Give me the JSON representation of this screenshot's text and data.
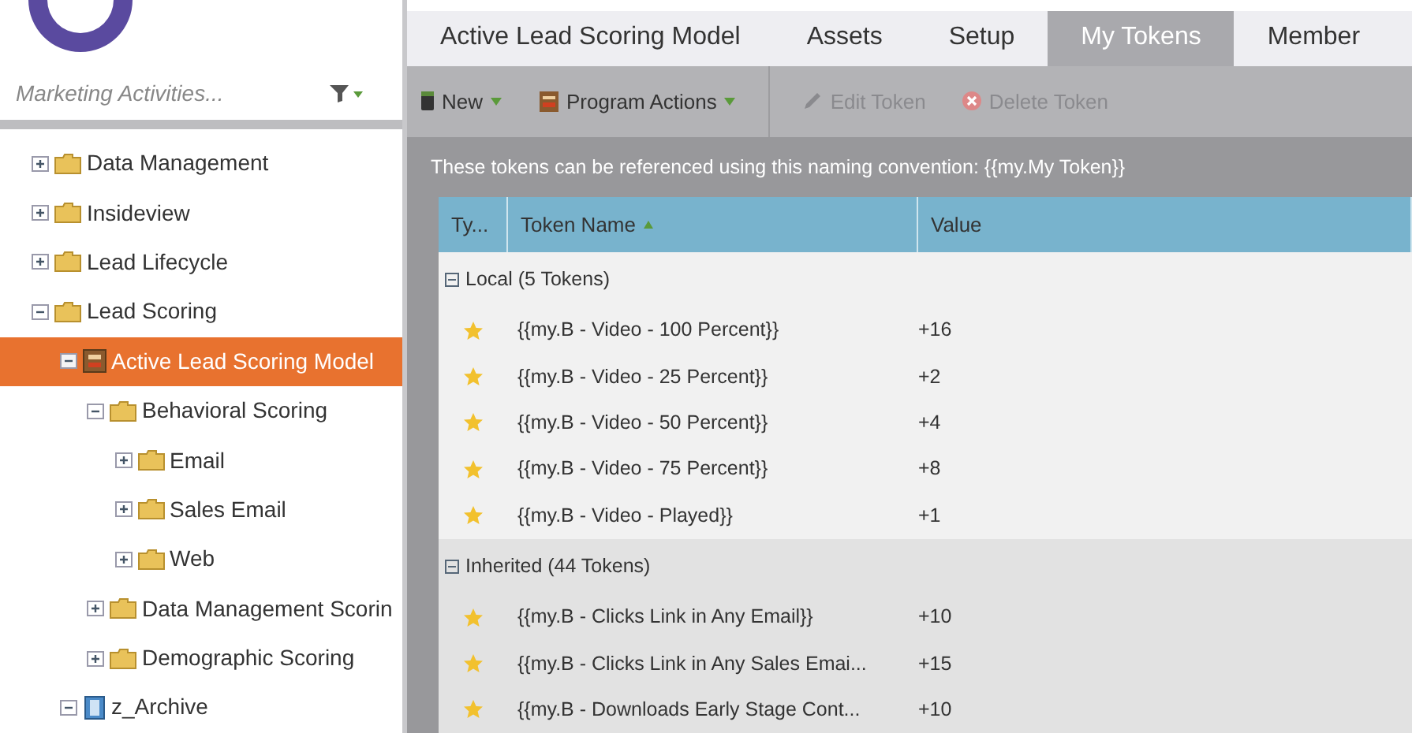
{
  "sidebar": {
    "search": {
      "placeholder": "Marketing Activities..."
    },
    "tree": [
      {
        "label": "Data Management",
        "kind": "folder",
        "expanded": false,
        "selected": false
      },
      {
        "label": "Insideview",
        "kind": "folder",
        "expanded": false,
        "selected": false
      },
      {
        "label": "Lead Lifecycle",
        "kind": "folder",
        "expanded": false,
        "selected": false
      },
      {
        "label": "Lead Scoring",
        "kind": "folder",
        "expanded": true,
        "selected": false,
        "children": [
          {
            "label": "Active Lead Scoring Model",
            "kind": "program",
            "expanded": true,
            "selected": true,
            "children": [
              {
                "label": "Behavioral Scoring",
                "kind": "folder",
                "expanded": true,
                "selected": false,
                "children": [
                  {
                    "label": "Email",
                    "kind": "folder",
                    "expanded": false,
                    "selected": false
                  },
                  {
                    "label": "Sales Email",
                    "kind": "folder",
                    "expanded": false,
                    "selected": false
                  },
                  {
                    "label": "Web",
                    "kind": "folder",
                    "expanded": false,
                    "selected": false
                  }
                ]
              },
              {
                "label": "Data Management Scorin",
                "kind": "folder",
                "expanded": false,
                "selected": false
              },
              {
                "label": "Demographic Scoring",
                "kind": "folder",
                "expanded": false,
                "selected": false
              }
            ]
          },
          {
            "label": "z_Archive",
            "kind": "archive",
            "expanded": true,
            "selected": false
          }
        ]
      }
    ]
  },
  "tabs": [
    {
      "label": "Active Lead Scoring Model",
      "selected": false
    },
    {
      "label": "Assets",
      "selected": false
    },
    {
      "label": "Setup",
      "selected": false
    },
    {
      "label": "My Tokens",
      "selected": true
    },
    {
      "label": "Member",
      "selected": false
    }
  ],
  "toolbar": [
    {
      "label": "New",
      "kind": "new",
      "menu": true,
      "disabled": false
    },
    {
      "label": "Program Actions",
      "kind": "program",
      "menu": true,
      "disabled": false
    },
    {
      "label": "Edit Token",
      "kind": "edit",
      "menu": false,
      "disabled": true
    },
    {
      "label": "Delete Token",
      "kind": "delete",
      "menu": false,
      "disabled": true
    }
  ],
  "info": "These tokens can be referenced using this naming convention: {{my.My Token}}",
  "table": {
    "columns": [
      "Ty...",
      "Token Name",
      "Value"
    ],
    "groups": [
      {
        "label": "Local (5 Tokens)",
        "tokens": [
          {
            "name": "{{my.B - Video - 100 Percent}}",
            "value": "+16"
          },
          {
            "name": "{{my.B - Video - 25 Percent}}",
            "value": "+2"
          },
          {
            "name": "{{my.B - Video - 50 Percent}}",
            "value": "+4"
          },
          {
            "name": "{{my.B - Video - 75 Percent}}",
            "value": "+8"
          },
          {
            "name": "{{my.B - Video - Played}}",
            "value": "+1"
          }
        ]
      },
      {
        "label": "Inherited (44 Tokens)",
        "tokens": [
          {
            "name": "{{my.B - Clicks Link in Any Email}}",
            "value": "+10"
          },
          {
            "name": "{{my.B - Clicks Link in Any Sales Emai...",
            "value": "+15"
          },
          {
            "name": "{{my.B - Downloads Early Stage Cont...",
            "value": "+10"
          }
        ]
      }
    ]
  }
}
